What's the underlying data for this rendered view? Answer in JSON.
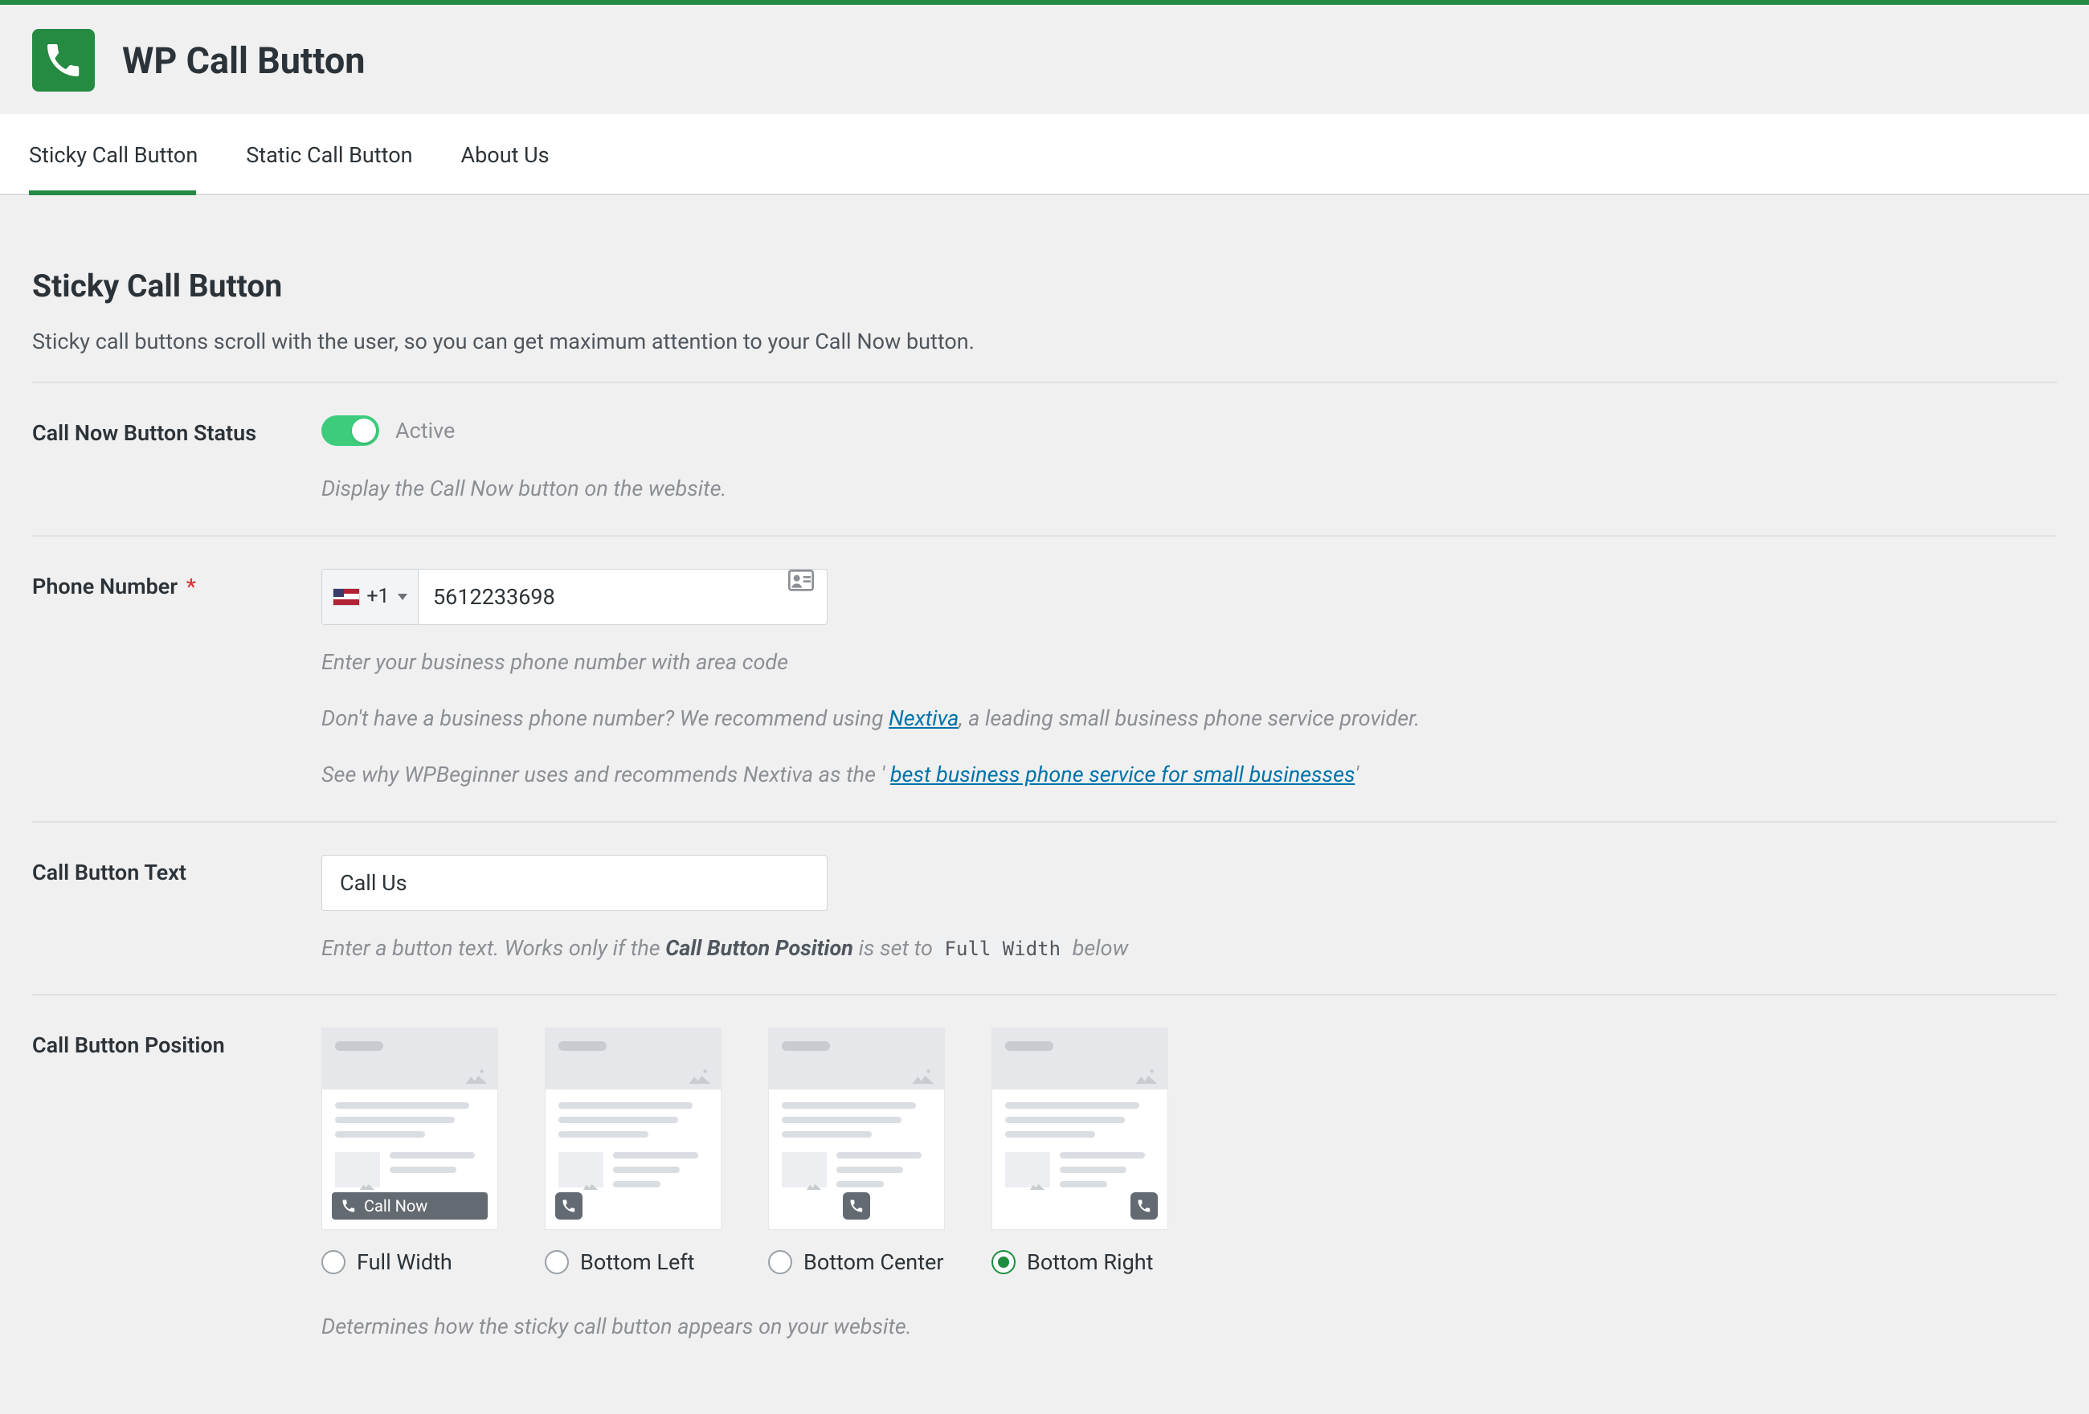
{
  "header": {
    "title": "WP Call Button"
  },
  "tabs": [
    {
      "id": "sticky",
      "label": "Sticky Call Button",
      "active": true
    },
    {
      "id": "static",
      "label": "Static Call Button",
      "active": false
    },
    {
      "id": "about",
      "label": "About Us",
      "active": false
    }
  ],
  "section": {
    "title": "Sticky Call Button",
    "description": "Sticky call buttons scroll with the user, so you can get maximum attention to your Call Now button."
  },
  "status": {
    "label": "Call Now Button Status",
    "state_label": "Active",
    "help": "Display the Call Now button on the website."
  },
  "phone": {
    "label": "Phone Number",
    "required": "*",
    "dial_code": "+1",
    "value": "5612233698",
    "help1": "Enter your business phone number with area code",
    "help2_pre": "Don't have a business phone number? We recommend using ",
    "help2_link": "Nextiva",
    "help2_post": ", a leading small business phone service provider.",
    "help3_pre": "See why WPBeginner uses and recommends Nextiva as the '",
    "help3_link": "best business phone service for small businesses",
    "help3_post": "'"
  },
  "button_text": {
    "label": "Call Button Text",
    "value": "Call Us",
    "help_pre": "Enter a button text. Works only if the ",
    "help_strong": "Call Button Position",
    "help_mid": " is set to ",
    "help_code": "Full Width",
    "help_post": " below"
  },
  "position": {
    "label": "Call Button Position",
    "preview_call_label": "Call Now",
    "options": [
      {
        "id": "full",
        "label": "Full Width",
        "checked": false
      },
      {
        "id": "bl",
        "label": "Bottom Left",
        "checked": false
      },
      {
        "id": "bc",
        "label": "Bottom Center",
        "checked": false
      },
      {
        "id": "br",
        "label": "Bottom Right",
        "checked": true
      }
    ],
    "help": "Determines how the sticky call button appears on your website."
  },
  "colors": {
    "accent": "#258a42",
    "link": "#0073aa"
  }
}
